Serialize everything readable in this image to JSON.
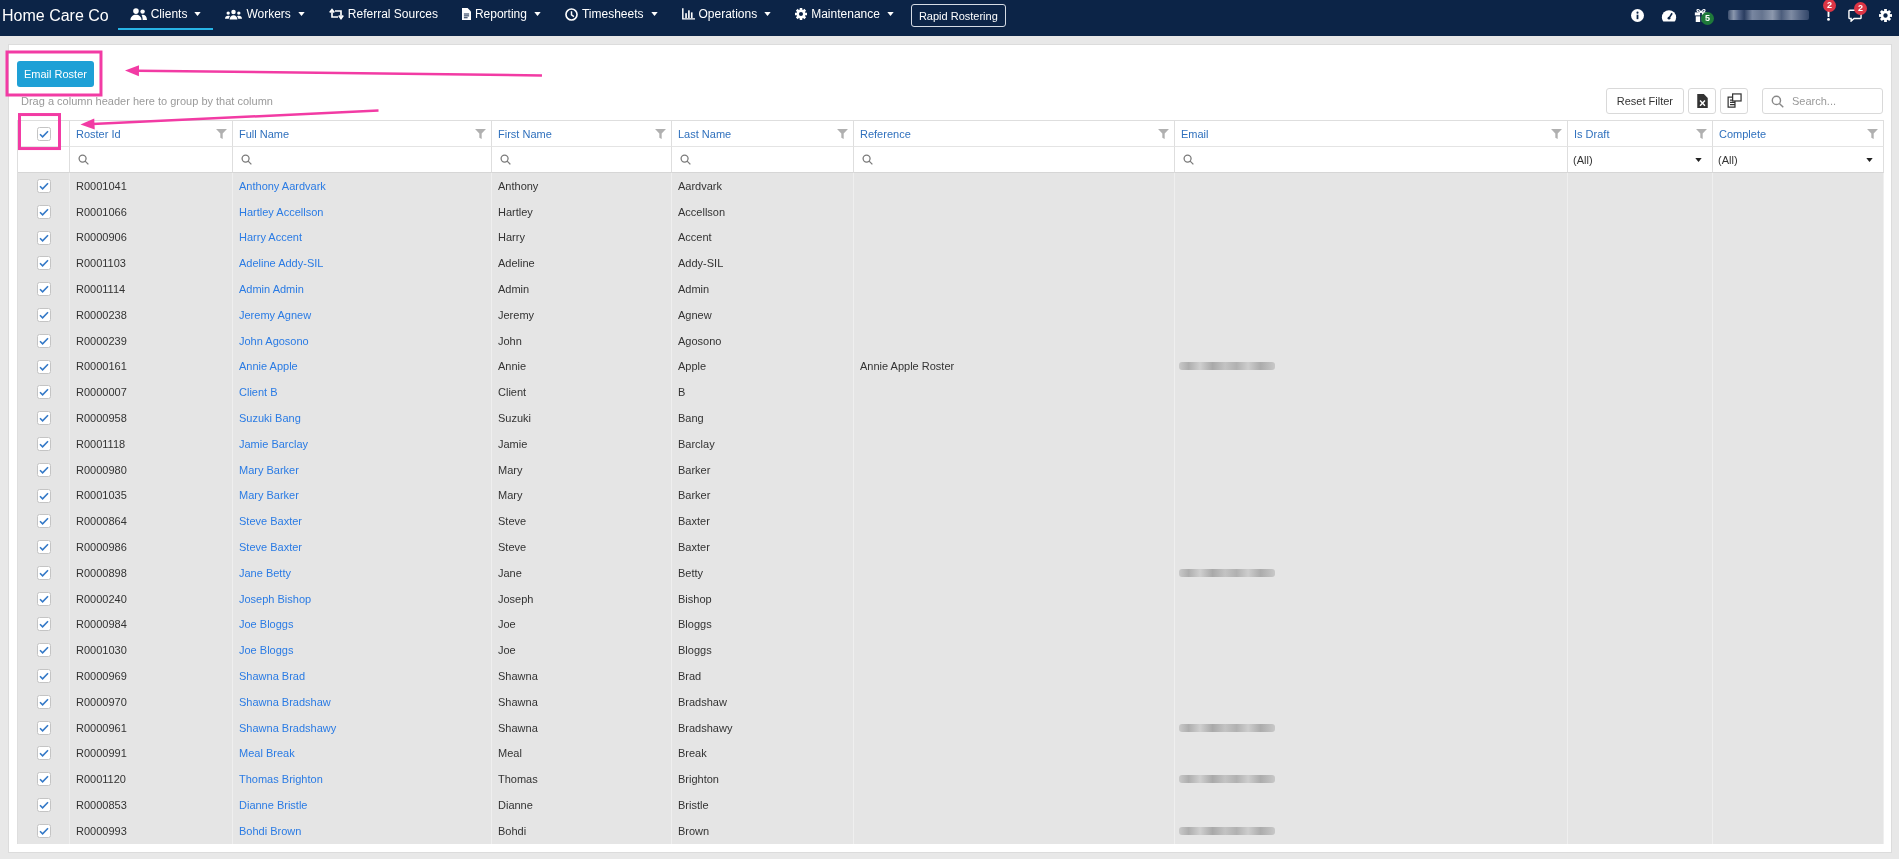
{
  "nav": {
    "brand": "Home Care Co",
    "items": [
      {
        "kind": "menu",
        "label": "Clients",
        "dropdown": true,
        "selected": true
      },
      {
        "kind": "menu",
        "label": "Workers",
        "dropdown": true,
        "selected": false
      },
      {
        "kind": "menu",
        "label": "Referral Sources",
        "dropdown": false,
        "selected": false
      },
      {
        "kind": "menu",
        "label": "Reporting",
        "dropdown": true,
        "selected": false
      },
      {
        "kind": "menu",
        "label": "Timesheets",
        "dropdown": true,
        "selected": false
      },
      {
        "kind": "menu",
        "label": "Operations",
        "dropdown": true,
        "selected": false
      },
      {
        "kind": "menu",
        "label": "Maintenance",
        "dropdown": true,
        "selected": false
      },
      {
        "kind": "button",
        "label": "Rapid Rostering",
        "selected": false
      }
    ],
    "tools": [
      {
        "kind": "icon"
      },
      {
        "kind": "icon"
      },
      {
        "kind": "icon",
        "badge": {
          "text": "5",
          "color": "#1f7a3a"
        }
      },
      {
        "kind": "user",
        "name_blurred": true
      },
      {
        "kind": "icon",
        "badge": {
          "text": "2",
          "color": "#dc3545"
        }
      },
      {
        "kind": "icon",
        "badge": {
          "text": "2",
          "color": "#dc3545"
        }
      },
      {
        "kind": "icon"
      }
    ]
  },
  "toolbar": {
    "email_button": {
      "label": "Email Roster",
      "highlighted": true
    },
    "group_hint": "Drag a column header here to group by that column",
    "reset_button": "Reset Filter",
    "search": {
      "placeholder": "Search..."
    }
  },
  "grid": {
    "select_all": {
      "checked": true,
      "highlighted": true
    },
    "columns": [
      {
        "label": "Roster Id",
        "filter": {
          "kind": "search"
        }
      },
      {
        "label": "Full Name",
        "filter": {
          "kind": "search"
        }
      },
      {
        "label": "First Name",
        "filter": {
          "kind": "search"
        }
      },
      {
        "label": "Last Name",
        "filter": {
          "kind": "search"
        }
      },
      {
        "label": "Reference",
        "filter": {
          "kind": "search"
        }
      },
      {
        "label": "Email",
        "filter": {
          "kind": "search"
        }
      },
      {
        "label": "Is Draft",
        "filter": {
          "kind": "select",
          "value": "(All)"
        }
      },
      {
        "label": "Complete",
        "filter": {
          "kind": "select",
          "value": "(All)"
        }
      }
    ],
    "rows": [
      {
        "selected": true,
        "roster_id": "R0001041",
        "full_name": "Anthony Aardvark",
        "first_name": "Anthony",
        "last_name": "Aardvark",
        "email_blurred": false
      },
      {
        "selected": true,
        "roster_id": "R0001066",
        "full_name": "Hartley Accellson",
        "first_name": "Hartley",
        "last_name": "Accellson",
        "email_blurred": false
      },
      {
        "selected": true,
        "roster_id": "R0000906",
        "full_name": "Harry Accent",
        "first_name": "Harry",
        "last_name": "Accent",
        "email_blurred": false
      },
      {
        "selected": true,
        "roster_id": "R0001103",
        "full_name": "Adeline Addy-SIL",
        "first_name": "Adeline",
        "last_name": "Addy-SIL",
        "email_blurred": false
      },
      {
        "selected": true,
        "roster_id": "R0001114",
        "full_name": "Admin Admin",
        "first_name": "Admin",
        "last_name": "Admin",
        "email_blurred": false
      },
      {
        "selected": true,
        "roster_id": "R0000238",
        "full_name": "Jeremy Agnew",
        "first_name": "Jeremy",
        "last_name": "Agnew",
        "email_blurred": false
      },
      {
        "selected": true,
        "roster_id": "R0000239",
        "full_name": "John Agosono",
        "first_name": "John",
        "last_name": "Agosono",
        "email_blurred": false
      },
      {
        "selected": true,
        "roster_id": "R0000161",
        "full_name": "Annie Apple",
        "first_name": "Annie",
        "last_name": "Apple",
        "reference": "Annie Apple Roster",
        "email_blurred": true
      },
      {
        "selected": true,
        "roster_id": "R0000007",
        "full_name": "Client B",
        "first_name": "Client",
        "last_name": "B",
        "email_blurred": false
      },
      {
        "selected": true,
        "roster_id": "R0000958",
        "full_name": "Suzuki Bang",
        "first_name": "Suzuki",
        "last_name": "Bang",
        "email_blurred": false
      },
      {
        "selected": true,
        "roster_id": "R0001118",
        "full_name": "Jamie Barclay",
        "first_name": "Jamie",
        "last_name": "Barclay",
        "email_blurred": false
      },
      {
        "selected": true,
        "roster_id": "R0000980",
        "full_name": "Mary Barker",
        "first_name": "Mary",
        "last_name": "Barker",
        "email_blurred": false
      },
      {
        "selected": true,
        "roster_id": "R0001035",
        "full_name": "Mary Barker",
        "first_name": "Mary",
        "last_name": "Barker",
        "email_blurred": false
      },
      {
        "selected": true,
        "roster_id": "R0000864",
        "full_name": "Steve Baxter",
        "first_name": "Steve",
        "last_name": "Baxter",
        "email_blurred": false
      },
      {
        "selected": true,
        "roster_id": "R0000986",
        "full_name": "Steve Baxter",
        "first_name": "Steve",
        "last_name": "Baxter",
        "email_blurred": false
      },
      {
        "selected": true,
        "roster_id": "R0000898",
        "full_name": "Jane Betty",
        "first_name": "Jane",
        "last_name": "Betty",
        "email_blurred": true
      },
      {
        "selected": true,
        "roster_id": "R0000240",
        "full_name": "Joseph Bishop",
        "first_name": "Joseph",
        "last_name": "Bishop",
        "email_blurred": false
      },
      {
        "selected": true,
        "roster_id": "R0000984",
        "full_name": "Joe Bloggs",
        "first_name": "Joe",
        "last_name": "Bloggs",
        "email_blurred": false
      },
      {
        "selected": true,
        "roster_id": "R0001030",
        "full_name": "Joe Bloggs",
        "first_name": "Joe",
        "last_name": "Bloggs",
        "email_blurred": false
      },
      {
        "selected": true,
        "roster_id": "R0000969",
        "full_name": "Shawna Brad",
        "first_name": "Shawna",
        "last_name": "Brad",
        "email_blurred": false
      },
      {
        "selected": true,
        "roster_id": "R0000970",
        "full_name": "Shawna Bradshaw",
        "first_name": "Shawna",
        "last_name": "Bradshaw",
        "email_blurred": false
      },
      {
        "selected": true,
        "roster_id": "R0000961",
        "full_name": "Shawna Bradshawy",
        "first_name": "Shawna",
        "last_name": "Bradshawy",
        "email_blurred": true
      },
      {
        "selected": true,
        "roster_id": "R0000991",
        "full_name": "Meal Break",
        "first_name": "Meal",
        "last_name": "Break",
        "email_blurred": false
      },
      {
        "selected": true,
        "roster_id": "R0001120",
        "full_name": "Thomas Brighton",
        "first_name": "Thomas",
        "last_name": "Brighton",
        "email_blurred": true
      },
      {
        "selected": true,
        "roster_id": "R0000853",
        "full_name": "Dianne Bristle",
        "first_name": "Dianne",
        "last_name": "Bristle",
        "email_blurred": false
      },
      {
        "selected": true,
        "roster_id": "R0000993",
        "full_name": "Bohdi Brown",
        "first_name": "Bohdi",
        "last_name": "Brown",
        "email_blurred": true
      }
    ]
  }
}
